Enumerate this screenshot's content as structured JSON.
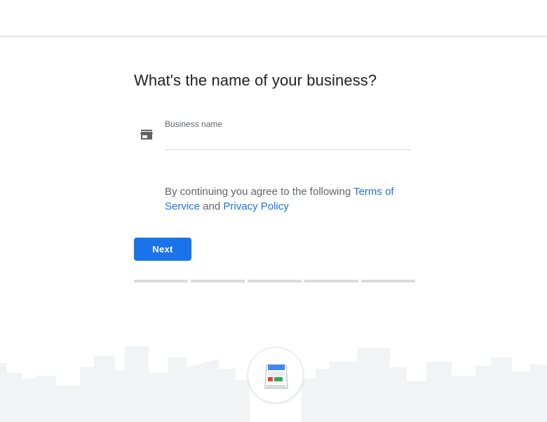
{
  "page": {
    "title": "What's the name of your business?"
  },
  "form": {
    "business_name_label": "Business name",
    "business_name_value": "",
    "field_icon": "store-icon"
  },
  "terms": {
    "prefix": "By continuing you agree to the following ",
    "terms_link": "Terms of Service",
    "connector": " and ",
    "privacy_link": "Privacy Policy"
  },
  "actions": {
    "next_label": "Next"
  },
  "progress": {
    "total_steps": 5,
    "active_steps": 0
  },
  "footer": {
    "logo_icon": "business-storefront-logo-icon"
  },
  "colors": {
    "accent": "#1a73e8",
    "link": "#1a73e8",
    "text_primary": "#202124",
    "text_secondary": "#5f6368",
    "divider": "#dadce0",
    "skyline": "#f1f3f4"
  }
}
